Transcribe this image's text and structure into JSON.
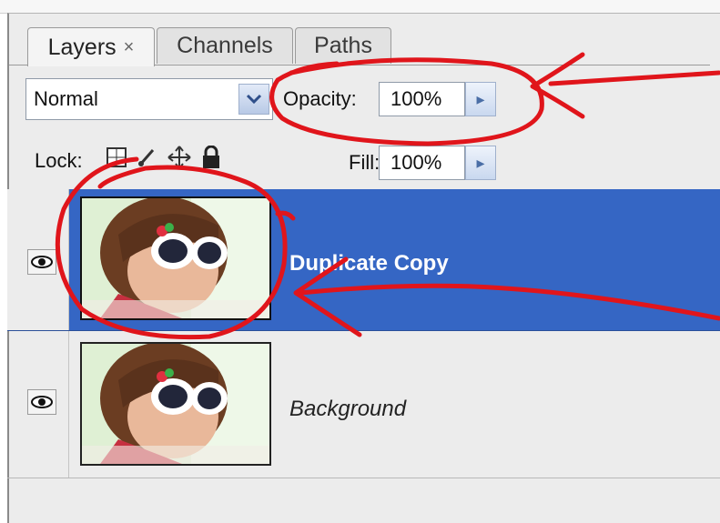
{
  "tabs": [
    {
      "label": "Layers",
      "close": "×"
    },
    {
      "label": "Channels"
    },
    {
      "label": "Paths"
    }
  ],
  "blend_mode": {
    "value": "Normal",
    "icon": "chevron-down-icon"
  },
  "opacity": {
    "label": "Opacity:",
    "value": "100%"
  },
  "lock": {
    "label": "Lock:",
    "icons": [
      "lock-transparent-pixels-icon",
      "lock-image-pixels-icon",
      "lock-position-icon",
      "lock-all-icon"
    ]
  },
  "fill": {
    "label": "Fill:",
    "value": "100%"
  },
  "layers": [
    {
      "name": "Duplicate Copy",
      "selected": true,
      "visible": true
    },
    {
      "name": "Background",
      "selected": false,
      "visible": true
    }
  ],
  "colors": {
    "selection": "#3566c4",
    "annotation": "#e0151b"
  }
}
